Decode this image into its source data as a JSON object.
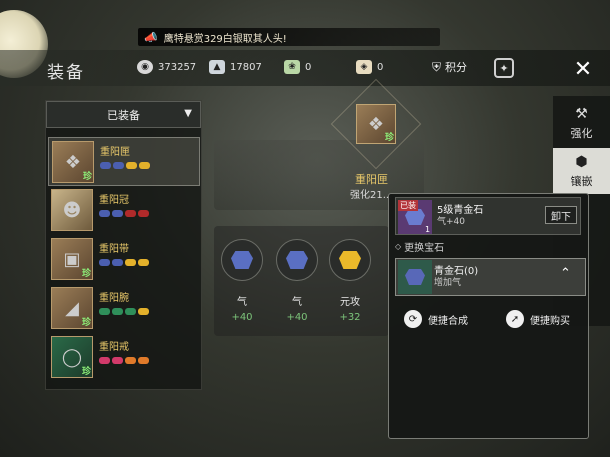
{
  "broadcast": {
    "text": "鹰特悬赏329白银取其人头!"
  },
  "header": {
    "title": "装备",
    "currencies": [
      {
        "icon": "film-reel-icon",
        "value": "373257"
      },
      {
        "icon": "silver-ingot-icon",
        "value": "17807"
      },
      {
        "icon": "leaf-token-icon",
        "value": "0"
      },
      {
        "icon": "bag-icon",
        "value": "0"
      }
    ],
    "score_label": "积分"
  },
  "equip_panel": {
    "filter_selected": "已装备",
    "items": [
      {
        "name": "重阳匣",
        "rarity": "珍",
        "icon": "gun-icon",
        "gems": [
          "#4b5fb0",
          "#4b5fb0",
          "#e3b12b",
          "#e3b12b"
        ]
      },
      {
        "name": "重阳冠",
        "rarity": "",
        "icon": "character-portrait-icon",
        "gems": [
          "#4b5fb0",
          "#4b5fb0",
          "#b02a2a",
          "#b02a2a"
        ]
      },
      {
        "name": "重阳带",
        "rarity": "珍",
        "icon": "belt-icon",
        "gems": [
          "#4b5fb0",
          "#4b5fb0",
          "#e3b12b",
          "#e3b12b"
        ]
      },
      {
        "name": "重阳腕",
        "rarity": "珍",
        "icon": "bracer-icon",
        "gems": [
          "#2f8f5a",
          "#2f8f5a",
          "#2f8f5a",
          "#e3b12b"
        ]
      },
      {
        "name": "重阳戒",
        "rarity": "珍",
        "icon": "ring-icon",
        "gems": [
          "#d23a6a",
          "#d23a6a",
          "#e07a2a",
          "#e07a2a"
        ]
      }
    ]
  },
  "center": {
    "item_name": "重阳匣",
    "item_rarity": "珍",
    "enhance_text": "强化21...",
    "slots": [
      {
        "attr": "气",
        "value": "+40",
        "color": "#4b5fb0"
      },
      {
        "attr": "气",
        "value": "+40",
        "color": "#4b5fb0"
      },
      {
        "attr": "元攻",
        "value": "+32",
        "color": "#e3b12b"
      }
    ]
  },
  "tabs": [
    {
      "label": "强化",
      "icon": "hammer-icon"
    },
    {
      "label": "镶嵌",
      "icon": "hexagon-gem-icon"
    }
  ],
  "popup": {
    "equipped_badge": "已装",
    "level_num": "1",
    "equipped_title": "5级青金石",
    "equipped_stat": "气+40",
    "unequip_label": "卸下",
    "replace_label": "更换宝石",
    "option_title": "青金石(0)",
    "option_sub": "增加气",
    "quick_synth_label": "便捷合成",
    "quick_buy_label": "便捷购买"
  }
}
